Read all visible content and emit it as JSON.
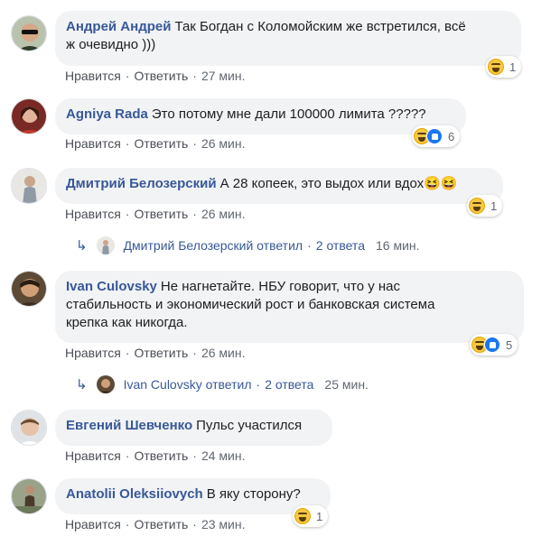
{
  "actions": {
    "like": "Нравится",
    "reply": "Ответить"
  },
  "comments": [
    {
      "author": "Андрей Андрей",
      "text_line1": "Так Богдан с Коломойским же встретился, всё",
      "text_line2": "ж очевидно )))",
      "time": "27 мин.",
      "reaction_count": "1"
    },
    {
      "author": "Agniya Rada",
      "text_line1": "Это потому мне дали 100000 лимита ?????",
      "time": "26 мин.",
      "reaction_count": "6"
    },
    {
      "author": "Дмитрий Белозерский",
      "text_line1": "А 28 копеек, это выдох или вдох😆😆",
      "time": "26 мин.",
      "reaction_count": "1",
      "replies_author": "Дмитрий Белозерский ответил",
      "replies_count": "2 ответа",
      "replies_time": "16 мин."
    },
    {
      "author": "Ivan Culovsky",
      "text_line1": "Не нагнетайте. НБУ говорит, что у нас",
      "text_line2": "стабильность и экономический рост и банковская система",
      "text_line3": "крепка как никогда.",
      "time": "26 мин.",
      "reaction_count": "5",
      "replies_author": "Ivan Culovsky ответил",
      "replies_count": "2 ответа",
      "replies_time": "25 мин."
    },
    {
      "author": "Евгений Шевченко",
      "text_line1": "Пульс участился",
      "time": "24 мин."
    },
    {
      "author": "Anatolii Oleksiiovych",
      "text_line1": "В яку сторону?",
      "time": "23 мин.",
      "reaction_count": "1"
    }
  ],
  "colors": {
    "author": "#385898",
    "bubble": "#f2f3f5",
    "meta": "#606770"
  }
}
